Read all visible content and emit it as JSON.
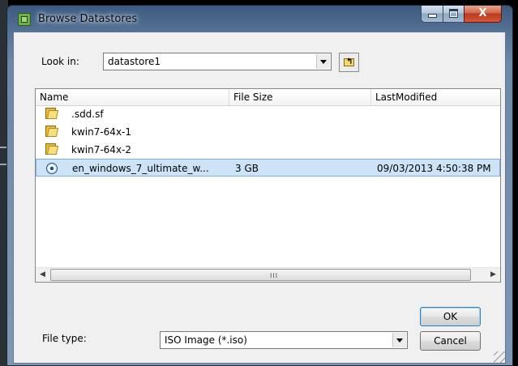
{
  "window": {
    "title": "Browse Datastores",
    "controls": {
      "close_glyph": "X"
    }
  },
  "look_in": {
    "label": "Look in:",
    "value": "datastore1"
  },
  "file_list": {
    "columns": [
      "Name",
      "File Size",
      "LastModified"
    ],
    "rows": [
      {
        "icon": "folder-icon",
        "name": ".sdd.sf",
        "size": "",
        "modified": ""
      },
      {
        "icon": "folder-icon",
        "name": "kwin7-64x-1",
        "size": "",
        "modified": ""
      },
      {
        "icon": "folder-icon",
        "name": "kwin7-64x-2",
        "size": "",
        "modified": ""
      },
      {
        "icon": "iso-disc-icon",
        "name": "en_windows_7_ultimate_w...",
        "size": "3 GB",
        "modified": "09/03/2013 4:50:38 PM",
        "selected": true
      }
    ],
    "scroll_grip": "III"
  },
  "file_type": {
    "label": "File type:",
    "value": "ISO Image (*.iso)"
  },
  "buttons": {
    "ok": "OK",
    "cancel": "Cancel"
  },
  "colors": {
    "selection": "#cde4f7",
    "close_button": "#c9472a",
    "titlebar": "#587496"
  }
}
